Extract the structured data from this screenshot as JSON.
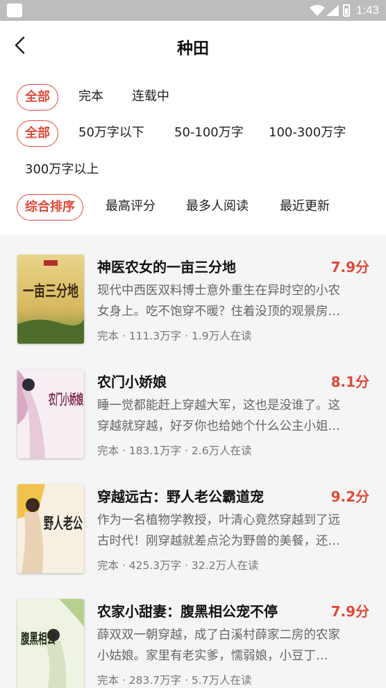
{
  "status_bar": {
    "time": "1:43"
  },
  "header": {
    "title": "种田"
  },
  "filters": {
    "status": [
      "全部",
      "完本",
      "连载中"
    ],
    "word_count": [
      "全部",
      "50万字以下",
      "50-100万字",
      "100-300万字",
      "300万字以上"
    ],
    "sort": [
      "综合排序",
      "最高评分",
      "最多人阅读",
      "最近更新"
    ]
  },
  "books": [
    {
      "title": "神医农女的一亩三分地",
      "score": "7.9分",
      "desc_line1": "现代中西医双料博士意外重生在异时空的小农",
      "desc_line2": "女身上。吃不饱穿不暖？住着没顶的观景房…",
      "meta": "完本 · 111.3万字 · 1.9万人在读",
      "cover_text": "一亩三分地"
    },
    {
      "title": "农门小娇娘",
      "score": "8.1分",
      "desc_line1": "睡一觉都能赶上穿越大军，这也是没谁了。这",
      "desc_line2": "穿越就穿越，好歹你也给她个什么公主小姐…",
      "meta": "完本 · 183.1万字 · 2.6万人在读",
      "cover_text": "农门小娇娘"
    },
    {
      "title": "穿越远古：野人老公霸道宠",
      "score": "9.2分",
      "desc_line1": "作为一名植物学教授，叶清心竟然穿越到了远",
      "desc_line2": "古时代！刚穿越就差点沦为野兽的美餐，还…",
      "meta": "完本 · 425.3万字 · 32.2万人在读",
      "cover_text": "野人老公"
    },
    {
      "title": "农家小甜妻：腹黑相公宠不停",
      "score": "7.9分",
      "desc_line1": "薛双双一朝穿越，成了白溪村薛家二房的农家",
      "desc_line2": "小姑娘。家里有老实爹，懦弱娘，小豆丁…",
      "meta": "完本 · 283.7万字 · 5.7万人在读",
      "cover_text": "腹黑相公"
    }
  ],
  "colors": {
    "accent": "#e0493a",
    "status_bar": "#bdbdbd"
  }
}
